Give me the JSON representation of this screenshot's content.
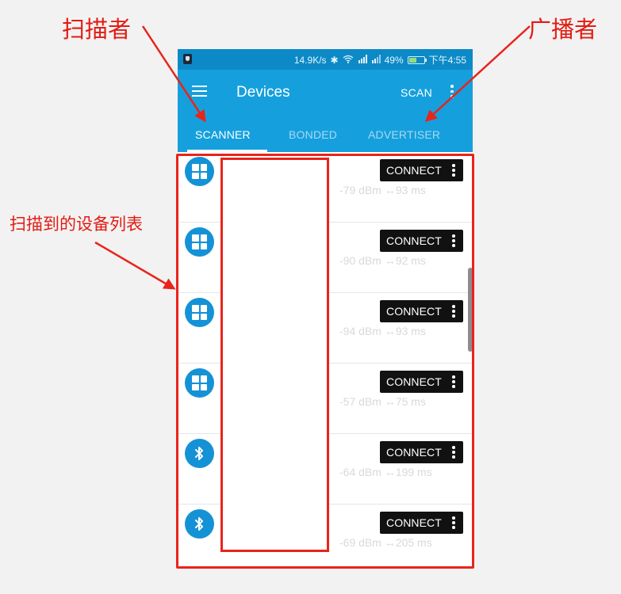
{
  "status_bar": {
    "speed": "14.9K/s",
    "battery": "49%",
    "time": "下午4:55",
    "sim_label": "3G"
  },
  "app_bar": {
    "title": "Devices",
    "scan_label": "SCAN"
  },
  "tabs": [
    {
      "label": "SCANNER",
      "active": true
    },
    {
      "label": "BONDED",
      "active": false
    },
    {
      "label": "ADVERTISER",
      "active": false
    }
  ],
  "devices": [
    {
      "type": "windows",
      "rssi": "-79 dBm",
      "interval": "93 ms",
      "connect_label": "CONNECT"
    },
    {
      "type": "windows",
      "rssi": "-90 dBm",
      "interval": "92 ms",
      "connect_label": "CONNECT"
    },
    {
      "type": "windows",
      "rssi": "-94 dBm",
      "interval": "93 ms",
      "connect_label": "CONNECT"
    },
    {
      "type": "windows",
      "rssi": "-57 dBm",
      "interval": "75 ms",
      "connect_label": "CONNECT"
    },
    {
      "type": "bluetooth",
      "rssi": "-64 dBm",
      "interval": "199 ms",
      "connect_label": "CONNECT"
    },
    {
      "type": "bluetooth",
      "rssi": "-69 dBm",
      "interval": "205 ms",
      "connect_label": "CONNECT"
    }
  ],
  "interval_symbol": "↔",
  "annotations": {
    "scanner": "扫描者",
    "advertiser": "广播者",
    "device_list": "扫描到的设备列表"
  },
  "colors": {
    "status_bar": "#0b8ac7",
    "app_bar": "#15a0dd",
    "device_icon": "#1592d6",
    "annotation_red": "#e8241b"
  }
}
